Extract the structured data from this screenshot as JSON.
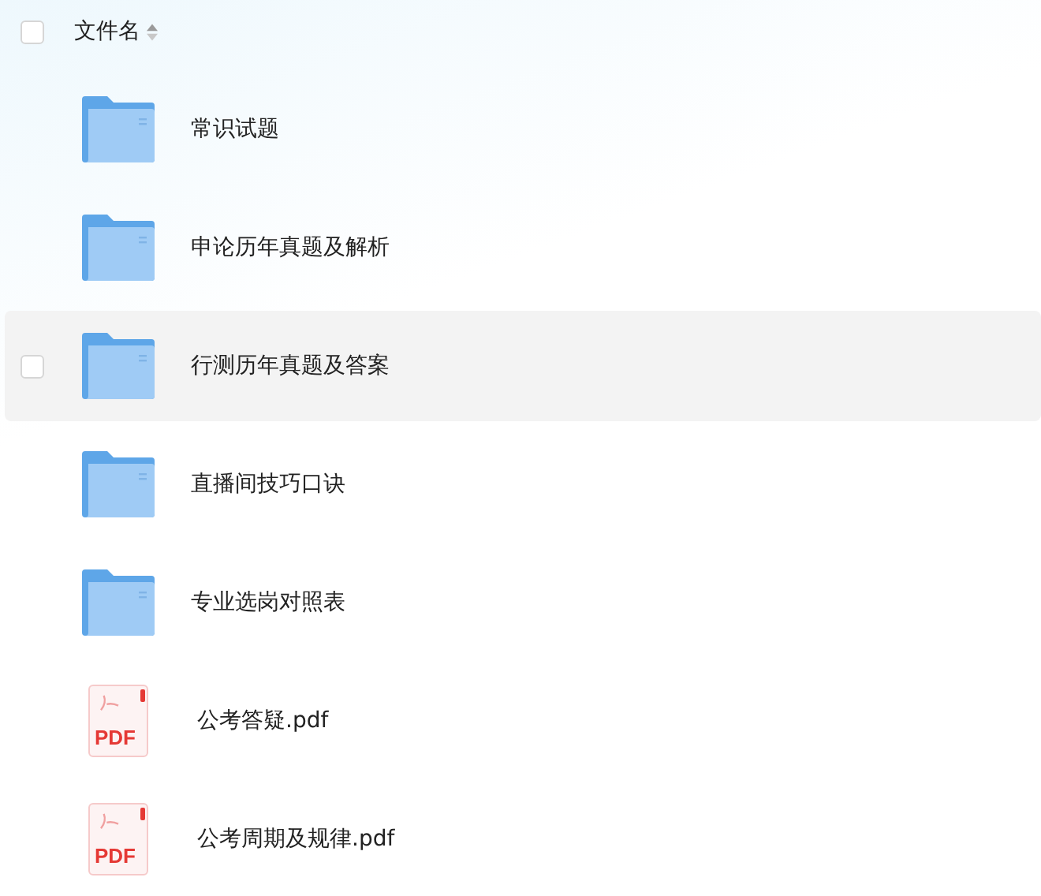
{
  "header": {
    "checked": false,
    "label": "文件名"
  },
  "files": [
    {
      "kind": "folder",
      "name": "常识试题",
      "hovered": false
    },
    {
      "kind": "folder",
      "name": "申论历年真题及解析",
      "hovered": false
    },
    {
      "kind": "folder",
      "name": "行测历年真题及答案",
      "hovered": true
    },
    {
      "kind": "folder",
      "name": "直播间技巧口诀",
      "hovered": false
    },
    {
      "kind": "folder",
      "name": "专业选岗对照表",
      "hovered": false
    },
    {
      "kind": "pdf",
      "name": "公考答疑.pdf",
      "icon_label": "PDF",
      "hovered": false
    },
    {
      "kind": "pdf",
      "name": "公考周期及规律.pdf",
      "icon_label": "PDF",
      "hovered": false
    }
  ]
}
